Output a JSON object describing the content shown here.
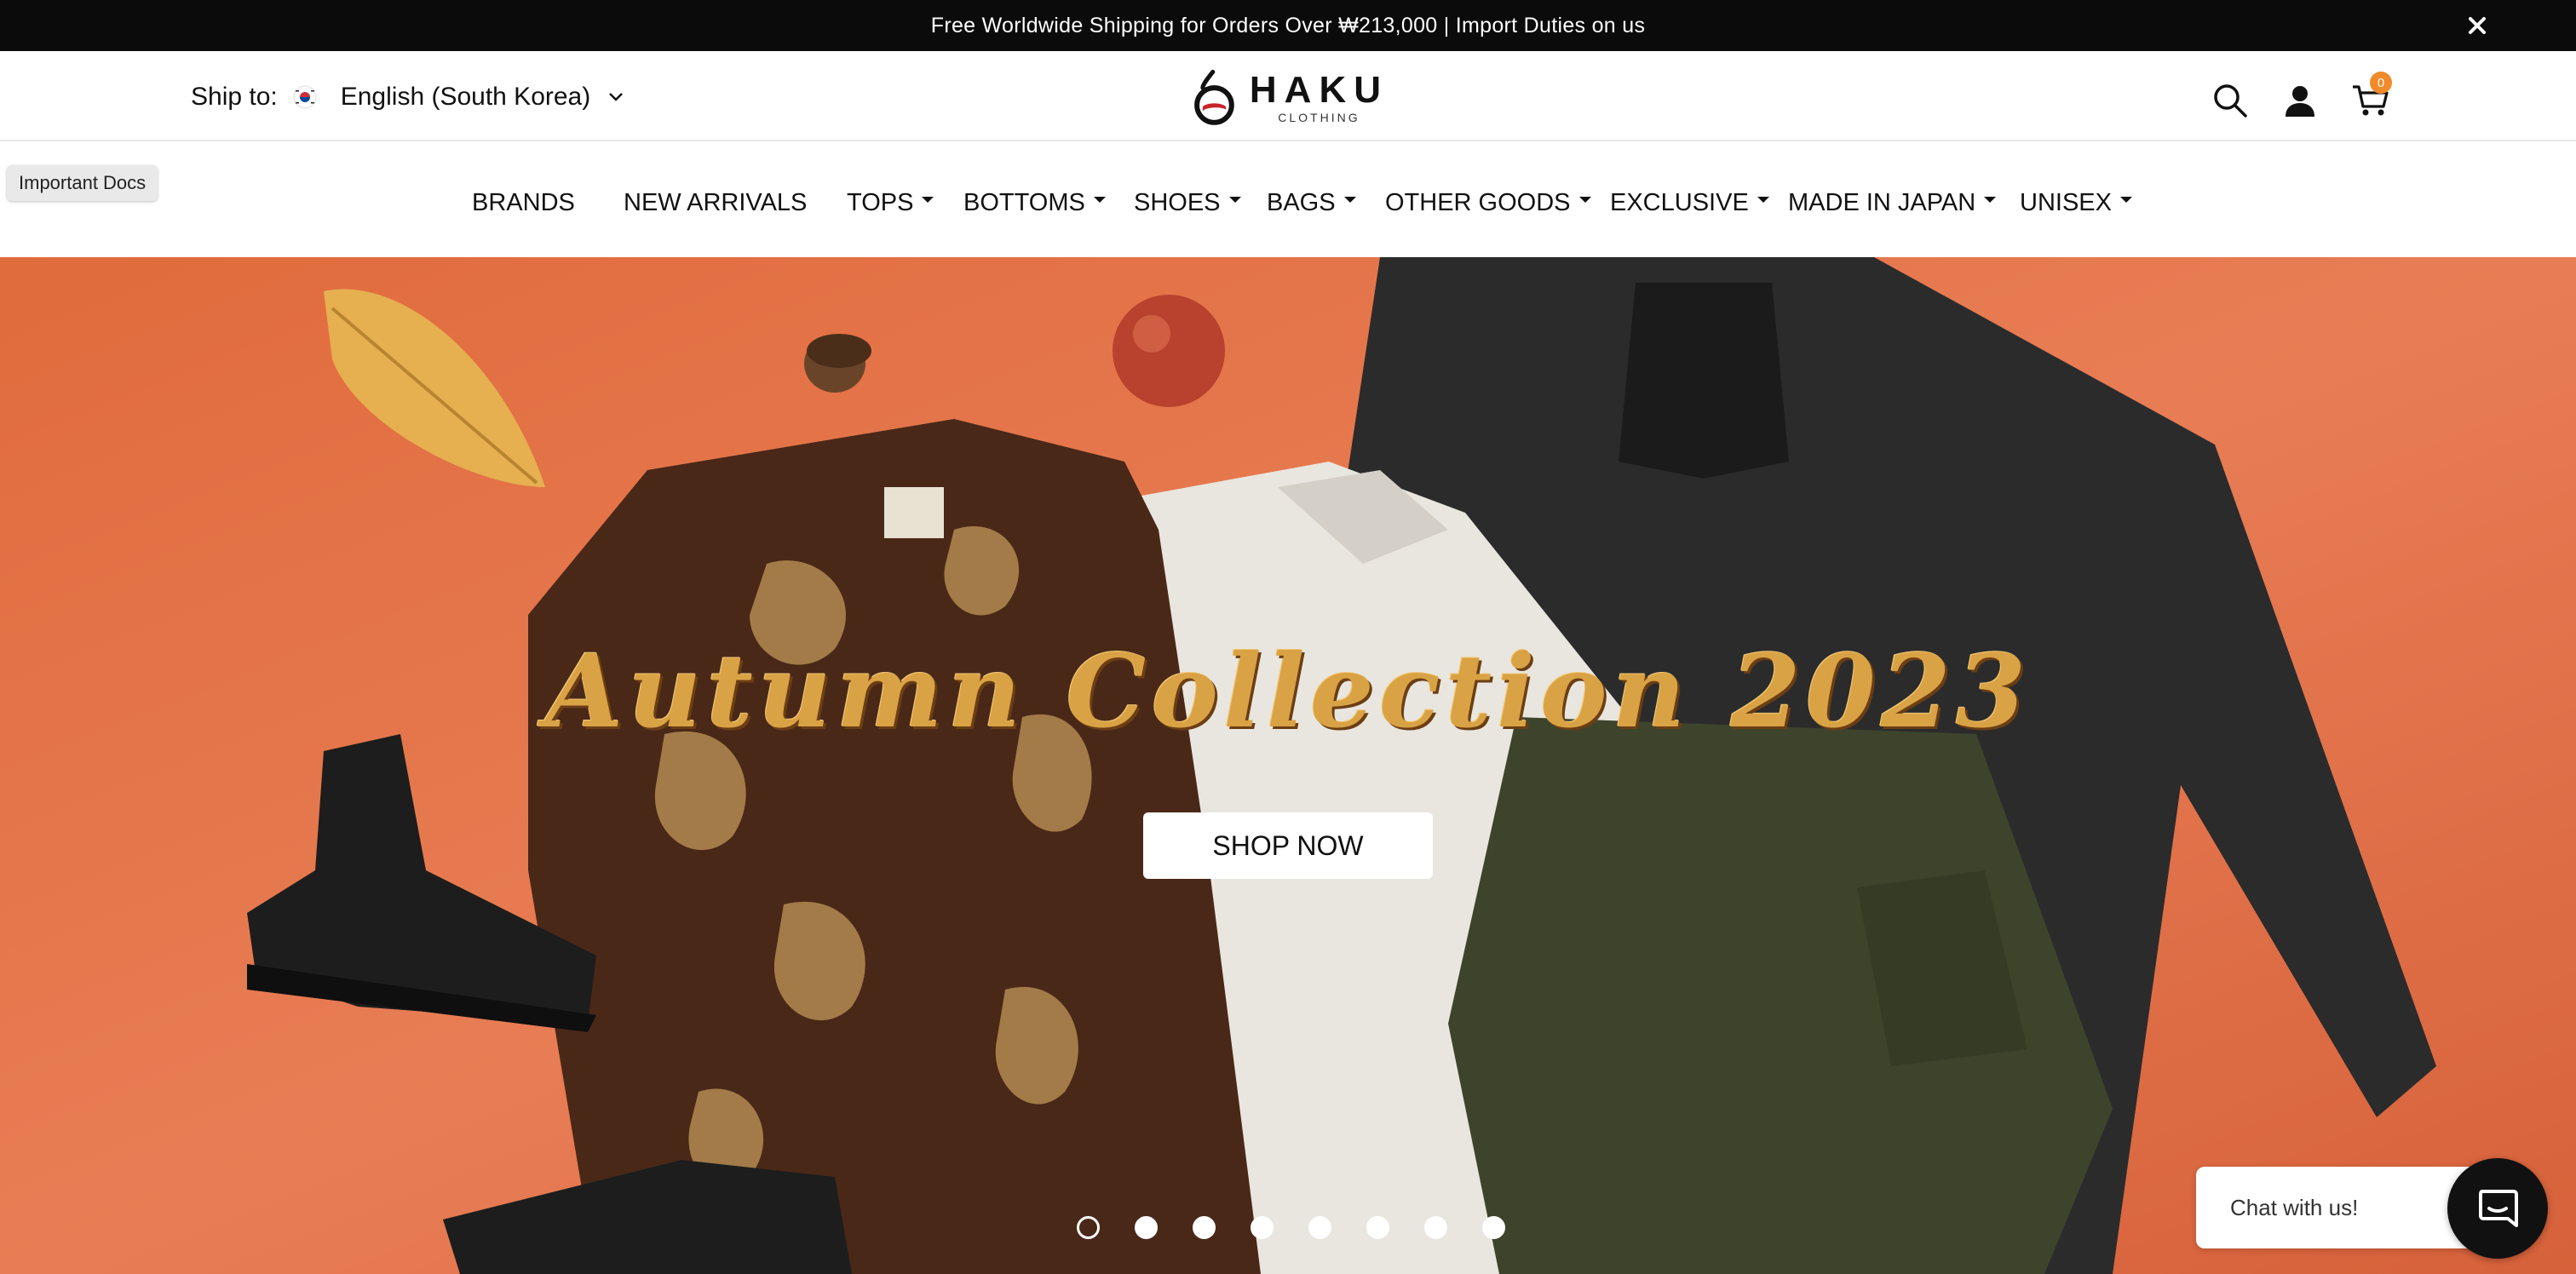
{
  "announcement": {
    "text": "Free Worldwide Shipping for Orders Over ₩213,000 | Import Duties on us",
    "close_icon": "close-icon"
  },
  "header": {
    "ship_to_label": "Ship to:",
    "language": "English (South Korea)",
    "logo_name": "HAKU",
    "logo_sub": "CLOTHING",
    "cart_count": "0"
  },
  "important_docs": "Important Docs",
  "nav": {
    "items": [
      {
        "label": "BRANDS",
        "dropdown": false
      },
      {
        "label": "NEW ARRIVALS",
        "dropdown": false
      },
      {
        "label": "TOPS",
        "dropdown": true
      },
      {
        "label": "BOTTOMS",
        "dropdown": true
      },
      {
        "label": "SHOES",
        "dropdown": true
      },
      {
        "label": "BAGS",
        "dropdown": true
      },
      {
        "label": "OTHER GOODS",
        "dropdown": true
      },
      {
        "label": "EXCLUSIVE",
        "dropdown": true
      },
      {
        "label": "MADE IN JAPAN",
        "dropdown": true
      },
      {
        "label": "UNISEX",
        "dropdown": true
      }
    ]
  },
  "hero": {
    "title": "Autumn Collection 2023",
    "cta": "SHOP NOW",
    "slide_count": 8,
    "active_slide": 1
  },
  "chat": {
    "label": "Chat with us!"
  },
  "colors": {
    "announcement_bg": "#0b0b0b",
    "hero_bg": "#e4774e",
    "hero_title": "#d9a244",
    "cart_badge": "#f08a2b"
  }
}
